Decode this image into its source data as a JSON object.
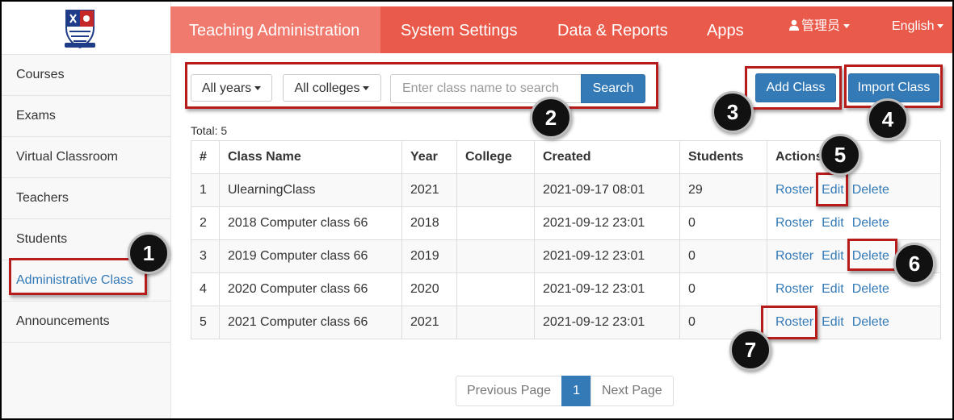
{
  "sidebar": {
    "items": [
      {
        "label": "Courses"
      },
      {
        "label": "Exams"
      },
      {
        "label": "Virtual Classroom"
      },
      {
        "label": "Teachers"
      },
      {
        "label": "Students"
      },
      {
        "label": "Administrative Class"
      },
      {
        "label": "Announcements"
      }
    ]
  },
  "nav": {
    "teaching": "Teaching Administration",
    "settings": "System Settings",
    "reports": "Data & Reports",
    "apps": "Apps",
    "user": "管理员",
    "language": "English"
  },
  "filters": {
    "years": "All years",
    "colleges": "All colleges",
    "search_placeholder": "Enter class name to search",
    "search_button": "Search"
  },
  "buttons": {
    "add_class": "Add Class",
    "import_class": "Import Class"
  },
  "total": "Total: 5",
  "table": {
    "headers": [
      "#",
      "Class Name",
      "Year",
      "College",
      "Created",
      "Students",
      "Actions"
    ],
    "rows": [
      {
        "num": "1",
        "name": "UlearningClass",
        "year": "2021",
        "college": "",
        "created": "2021-09-17 08:01",
        "students": "29"
      },
      {
        "num": "2",
        "name": "2018 Computer class 66",
        "year": "2018",
        "college": "",
        "created": "2021-09-12 23:01",
        "students": "0"
      },
      {
        "num": "3",
        "name": "2019 Computer class 66",
        "year": "2019",
        "college": "",
        "created": "2021-09-12 23:01",
        "students": "0"
      },
      {
        "num": "4",
        "name": "2020 Computer class 66",
        "year": "2020",
        "college": "",
        "created": "2021-09-12 23:01",
        "students": "0"
      },
      {
        "num": "5",
        "name": "2021 Computer class 66",
        "year": "2021",
        "college": "",
        "created": "2021-09-12 23:01",
        "students": "0"
      }
    ],
    "actions": {
      "roster": "Roster",
      "edit": "Edit",
      "delete": "Delete"
    }
  },
  "pagination": {
    "prev": "Previous Page",
    "current": "1",
    "next": "Next Page"
  },
  "callouts": [
    "1",
    "2",
    "3",
    "4",
    "5",
    "6",
    "7"
  ],
  "colors": {
    "nav_bg": "#ea5a4b",
    "nav_active": "#f07a6e",
    "primary": "#337ab7",
    "highlight": "#b71c1c"
  }
}
